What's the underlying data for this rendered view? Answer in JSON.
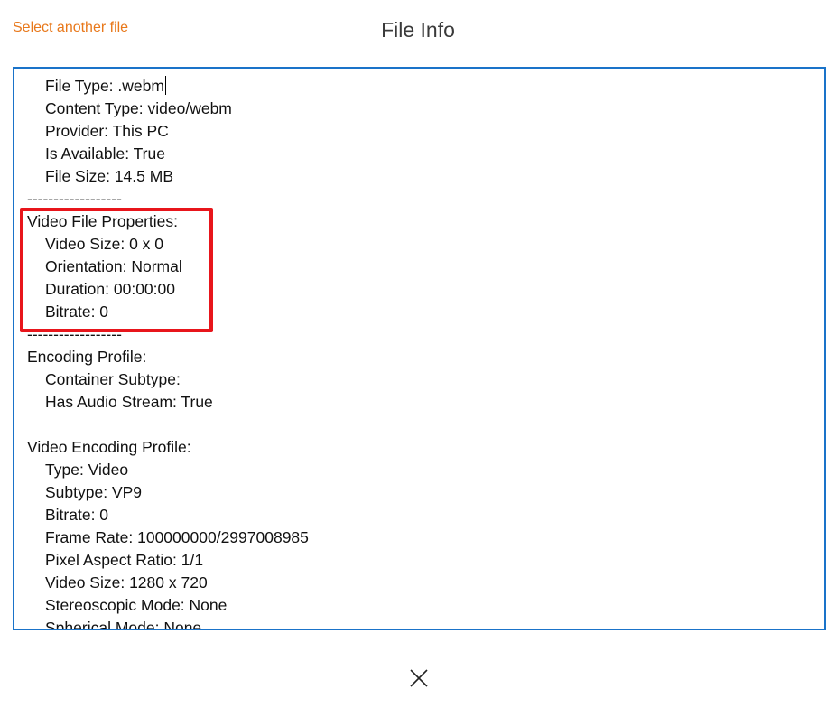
{
  "header": {
    "select_another_file": "Select another file",
    "title": "File Info"
  },
  "file_info": {
    "lines": [
      {
        "text": "File Type: .webm",
        "indent": true,
        "caret": true
      },
      {
        "text": "Content Type: video/webm",
        "indent": true
      },
      {
        "text": "Provider: This PC",
        "indent": true
      },
      {
        "text": "Is Available: True",
        "indent": true
      },
      {
        "text": "File Size: 14.5 MB",
        "indent": true
      },
      {
        "text": "------------------",
        "indent": false
      },
      {
        "text": "Video File Properties:",
        "indent": false
      },
      {
        "text": "Video Size: 0 x 0",
        "indent": true
      },
      {
        "text": "Orientation: Normal",
        "indent": true
      },
      {
        "text": "Duration: 00:00:00",
        "indent": true
      },
      {
        "text": "Bitrate: 0",
        "indent": true
      },
      {
        "text": "------------------",
        "indent": false
      },
      {
        "text": "Encoding Profile:",
        "indent": false
      },
      {
        "text": "Container Subtype:",
        "indent": true
      },
      {
        "text": "Has Audio Stream: True",
        "indent": true
      },
      {
        "text": "",
        "indent": false
      },
      {
        "text": "Video Encoding Profile:",
        "indent": false
      },
      {
        "text": "Type: Video",
        "indent": true
      },
      {
        "text": "Subtype: VP9",
        "indent": true
      },
      {
        "text": "Bitrate: 0",
        "indent": true
      },
      {
        "text": "Frame Rate: 100000000/2997008985",
        "indent": true
      },
      {
        "text": "Pixel Aspect Ratio: 1/1",
        "indent": true
      },
      {
        "text": "Video Size: 1280 x 720",
        "indent": true
      },
      {
        "text": "Stereoscopic Mode: None",
        "indent": true
      },
      {
        "text": "Spherical Mode: None",
        "indent": true
      }
    ]
  },
  "footer": {
    "close_icon": "close-icon"
  },
  "colors": {
    "link": "#e8781b",
    "textbox_border": "#1a73c9",
    "highlight": "#e8151b"
  }
}
